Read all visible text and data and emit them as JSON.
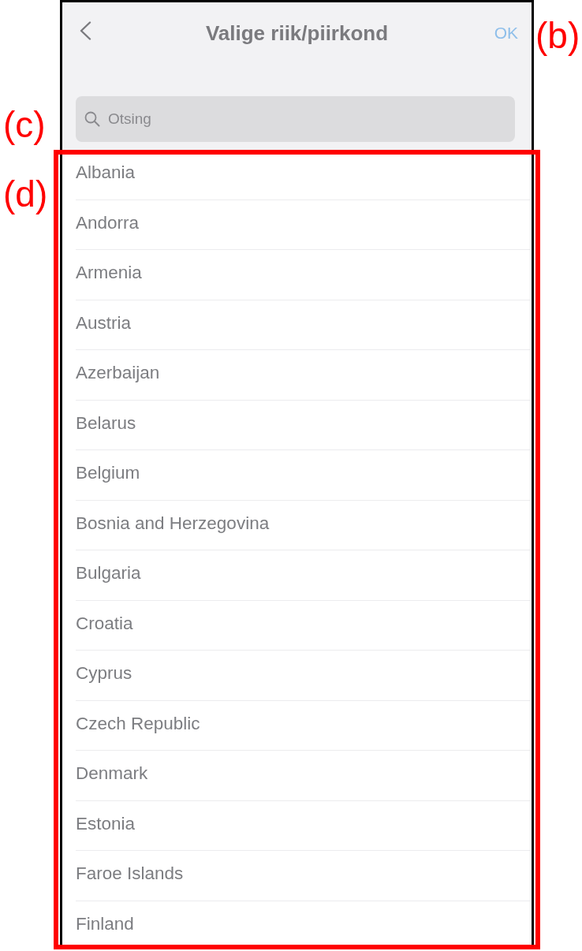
{
  "header": {
    "title": "Valige riik/piirkond",
    "ok_button": {
      "label": "OK",
      "disabled": true
    },
    "annotation": "(b)"
  },
  "search": {
    "placeholder": "Otsing",
    "annotation": "(c)"
  },
  "country_list": {
    "annotation": "(d)",
    "items": [
      "Albania",
      "Andorra",
      "Armenia",
      "Austria",
      "Azerbaijan",
      "Belarus",
      "Belgium",
      "Bosnia and Herzegovina",
      "Bulgaria",
      "Croatia",
      "Cyprus",
      "Czech Republic",
      "Denmark",
      "Estonia",
      "Faroe Islands",
      "Finland"
    ]
  }
}
